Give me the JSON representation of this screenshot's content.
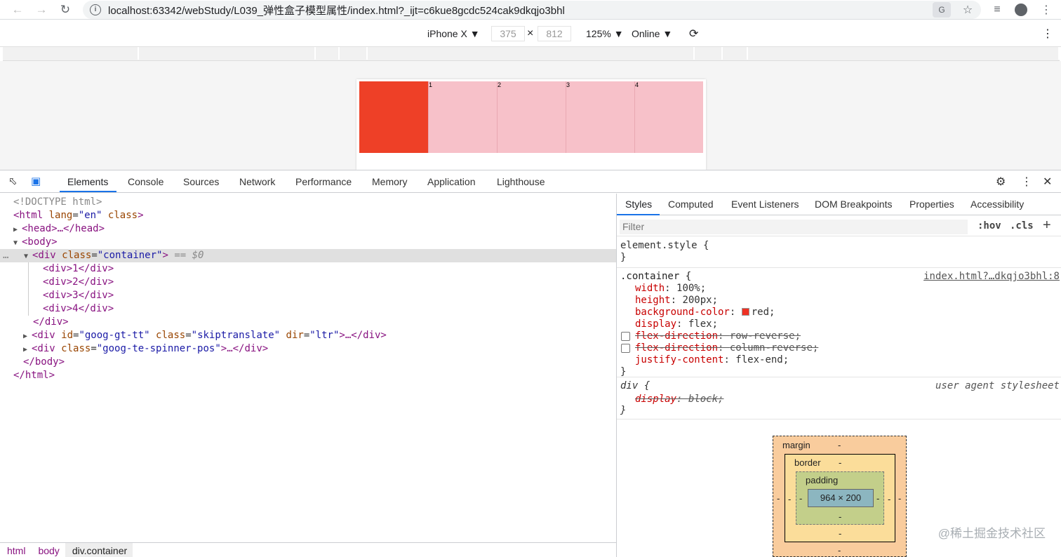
{
  "browser": {
    "url": "localhost:63342/webStudy/L039_弹性盒子模型属性/index.html?_ijt=c6kue8gcdc524cak9dkqjo3bhl",
    "icons": [
      "back-icon",
      "forward-icon",
      "reload-icon",
      "info-icon",
      "translate-icon",
      "star-icon",
      "playlist-icon",
      "profile-icon",
      "more-icon"
    ]
  },
  "device_toolbar": {
    "device": "iPhone X ▼",
    "width": "375",
    "times": "×",
    "height": "812",
    "zoom": "125% ▼",
    "network": "Online ▼"
  },
  "page": {
    "items": [
      "1",
      "2",
      "3",
      "4"
    ],
    "colors": {
      "container": "#ee4027",
      "item": "#f7c1c9"
    }
  },
  "devtools": {
    "tabs": [
      "Elements",
      "Console",
      "Sources",
      "Network",
      "Performance",
      "Memory",
      "Application",
      "Lighthouse"
    ],
    "active_tab": "Elements",
    "dom": {
      "doctype": "<!DOCTYPE html>",
      "html_open_tag": "<html",
      "html_attr_lang": "lang",
      "html_lang_val": "\"en\"",
      "html_attr_class": "class",
      "head": "<head>…</head>",
      "body_open": "<body>",
      "container_tag": "<div",
      "container_attr": "class",
      "container_val": "\"container\"",
      "selected_marker": "== $0",
      "children": [
        "<div>1</div>",
        "<div>2</div>",
        "<div>3</div>",
        "<div>4</div>"
      ],
      "div_close": "</div>",
      "gt_div_open": "<div",
      "gt_attr_id": "id",
      "gt_id_val": "\"goog-gt-tt\"",
      "gt_attr_class": "class",
      "gt_class_val": "\"skiptranslate\"",
      "gt_attr_dir": "dir",
      "gt_dir_val": "\"ltr\"",
      "gt_rest": ">…</div>",
      "sp_div_open": "<div",
      "sp_attr_class": "class",
      "sp_class_val": "\"goog-te-spinner-pos\"",
      "sp_rest": ">…</div>",
      "body_close": "</body>",
      "html_close": "</html>",
      "ellipsis": "…"
    },
    "breadcrumbs": [
      "html",
      "body",
      "div.container"
    ],
    "styles_tabs": [
      "Styles",
      "Computed",
      "Event Listeners",
      "DOM Breakpoints",
      "Properties",
      "Accessibility"
    ],
    "filter_placeholder": "Filter",
    "hov": ":hov",
    "cls": ".cls",
    "plus": "+",
    "element_style_open": "element.style {",
    "close_brace": "}",
    "container_rule": {
      "selector": ".container {",
      "source": "index.html?…dkqjo3bhl:8",
      "decls": [
        {
          "prop": "width",
          "val": "100%;"
        },
        {
          "prop": "height",
          "val": "200px;"
        },
        {
          "prop": "background-color",
          "val": "red;"
        },
        {
          "prop": "display",
          "val": "flex;"
        },
        {
          "prop": "flex-direction",
          "val": "row-reverse;"
        },
        {
          "prop": "flex-direction",
          "val": "column-reverse;"
        },
        {
          "prop": "justify-content",
          "val": "flex-end;"
        }
      ]
    },
    "ua_rule": {
      "selector": "div {",
      "source": "user agent stylesheet",
      "prop": "display",
      "val": "block;"
    },
    "box_model": {
      "margin": "margin",
      "border": "border",
      "padding": "padding",
      "content": "964 × 200",
      "dash": "-"
    }
  },
  "watermark": "@稀土掘金技术社区"
}
